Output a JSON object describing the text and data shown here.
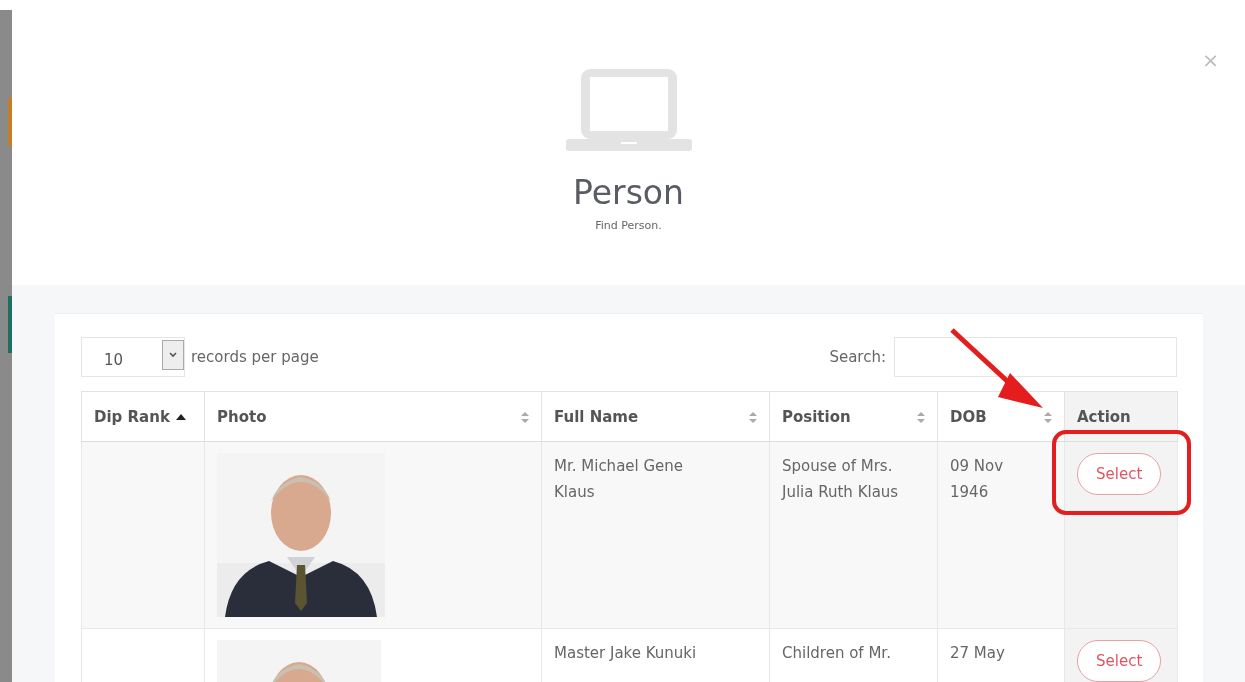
{
  "dialog": {
    "title": "Person",
    "subtitle": "Find Person.",
    "close": "×"
  },
  "page_length": {
    "value": "10",
    "label": "records per page"
  },
  "search": {
    "label": "Search:"
  },
  "table": {
    "columns": [
      {
        "label": "Dip Rank",
        "sortable": true,
        "sorted": true
      },
      {
        "label": "Photo",
        "sortable": true,
        "sorted": false
      },
      {
        "label": "Full Name",
        "sortable": true,
        "sorted": false
      },
      {
        "label": "Position",
        "sortable": true,
        "sorted": false
      },
      {
        "label": "DOB",
        "sortable": true,
        "sorted": false
      },
      {
        "label": "Action",
        "sortable": false
      }
    ],
    "rows": [
      {
        "full_name": "Mr. Michael Gene Klaus",
        "position": "Spouse of Mrs. Julia Ruth Klaus",
        "dob": "09 Nov 1946",
        "action": "Select",
        "highlighted": true
      },
      {
        "full_name": "Master Jake Kunuki",
        "position": "Children of Mr.",
        "dob": "27 May",
        "action": "Select",
        "highlighted": false
      }
    ]
  }
}
